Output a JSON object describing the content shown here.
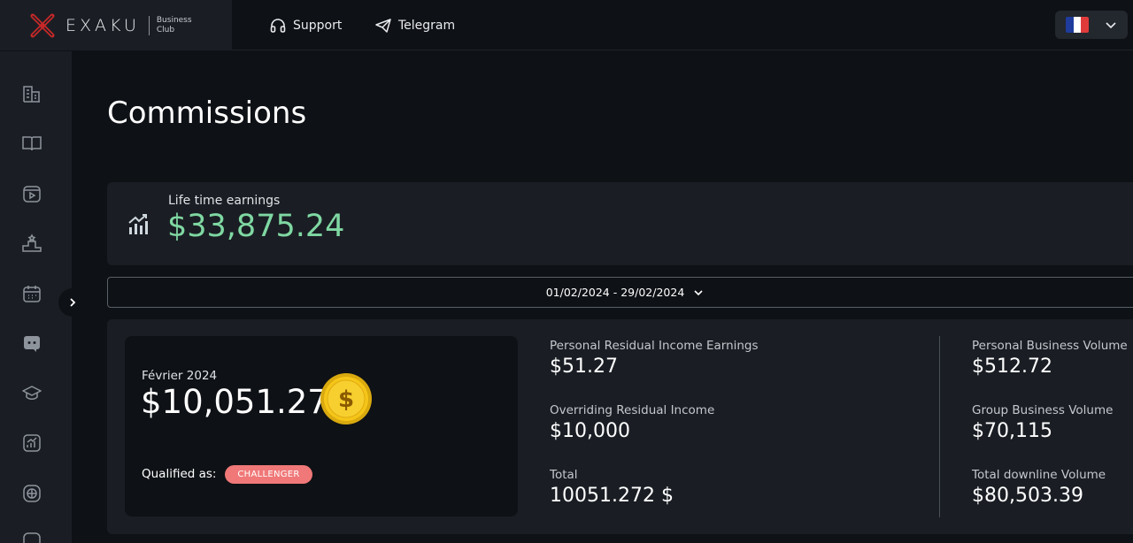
{
  "brand": {
    "name": "EXAKU",
    "sub_line1": "Business",
    "sub_line2": "Club"
  },
  "nav": {
    "support": "Support",
    "telegram": "Telegram"
  },
  "language": {
    "flag": "fr",
    "colors": [
      "#1f3c9c",
      "#ffffff",
      "#e03b3b"
    ]
  },
  "sidebar": {
    "icons": [
      "buildings-icon",
      "book-icon",
      "video-icon",
      "podium-icon",
      "calendar-icon",
      "discord-icon",
      "graduation-cap-icon",
      "chart-icon",
      "globe-icon",
      "more-icon"
    ]
  },
  "page": {
    "title": "Commissions"
  },
  "lifetime": {
    "label": "Life time earnings",
    "value": "$33,875.24"
  },
  "date_range": {
    "value": "01/02/2024 - 29/02/2024"
  },
  "month": {
    "label": "Février 2024",
    "value": "$10,051.27",
    "qualified_label": "Qualified as:",
    "rank": "CHALLENGER"
  },
  "stats": {
    "personal_residual": {
      "label": "Personal Residual Income Earnings",
      "value": "$51.27"
    },
    "overriding_residual": {
      "label": "Overriding Residual Income",
      "value": "$10,000"
    },
    "total": {
      "label": "Total",
      "value": "10051.272 $"
    },
    "personal_volume": {
      "label": "Personal Business Volume",
      "value": "$512.72"
    },
    "group_volume": {
      "label": "Group Business Volume",
      "value": "$70,115"
    },
    "downline_volume": {
      "label": "Total downline Volume",
      "value": "$80,503.39"
    }
  },
  "colors": {
    "accent_green": "#7fd8a2",
    "badge_red": "#f07878",
    "coin_gold": "#f5c518"
  }
}
